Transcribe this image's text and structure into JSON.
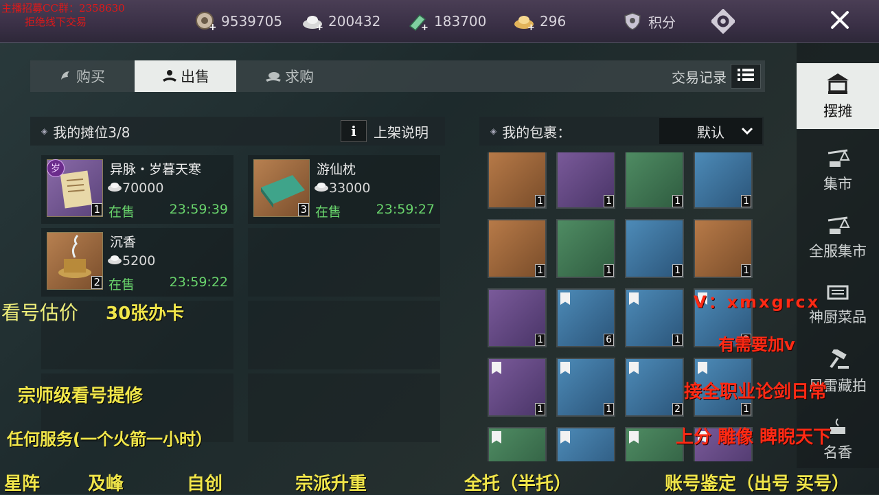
{
  "stream_overlay": {
    "top_left": [
      "主播招募CC群：2358630",
      "拒绝线下交易"
    ],
    "left_lines": [
      "看号估价",
      "30张办卡",
      "宗师级看号提修",
      "任何服务(一个火箭一小时）"
    ],
    "right_lines": [
      "V：xmxgrcx",
      "有需要加v",
      "接全职业论剑日常",
      "上分 雕像 睥睨天下"
    ],
    "bottom_line": [
      "星阵",
      "及峰",
      "自创",
      "宗派升重",
      "全托（半托）",
      "账号鉴定（出号 买号）"
    ]
  },
  "currencies": [
    {
      "icon": "coin-add-icon",
      "value": "9539705"
    },
    {
      "icon": "silver-ingot-icon",
      "value": "200432"
    },
    {
      "icon": "jade-add-icon",
      "value": "183700"
    },
    {
      "icon": "gold-ingot-icon",
      "value": "296"
    }
  ],
  "points_label": "积分",
  "tabs": [
    {
      "label": "购买",
      "icon": "buy-icon"
    },
    {
      "label": "出售",
      "icon": "sell-icon"
    },
    {
      "label": "求购",
      "icon": "request-icon"
    }
  ],
  "trade_record_label": "交易记录",
  "stall": {
    "title": "我的摊位3/8",
    "info_label": "i",
    "guide_label": "上架说明",
    "items": [
      {
        "name": "异脉・岁暮天寒",
        "price": "70000",
        "status": "在售",
        "timer": "23:59:39",
        "qty": "1",
        "badge": "岁"
      },
      {
        "name": "游仙枕",
        "price": "33000",
        "status": "在售",
        "timer": "23:59:27",
        "qty": "3"
      },
      {
        "name": "沉香",
        "price": "5200",
        "status": "在售",
        "timer": "23:59:22",
        "qty": "2"
      }
    ]
  },
  "bag": {
    "title": "我的包裹：",
    "sort_value": "默认",
    "cells": [
      {
        "q": "1",
        "color": "orange",
        "tag": false
      },
      {
        "q": "1",
        "color": "purple",
        "tag": false
      },
      {
        "q": "1",
        "color": "green",
        "tag": false
      },
      {
        "q": "1",
        "color": "blue",
        "tag": false
      },
      {
        "q": "1",
        "color": "orange",
        "tag": false
      },
      {
        "q": "1",
        "color": "green",
        "tag": false
      },
      {
        "q": "1",
        "color": "blue",
        "tag": false
      },
      {
        "q": "1",
        "color": "orange",
        "tag": false
      },
      {
        "q": "1",
        "color": "purple",
        "tag": false
      },
      {
        "q": "6",
        "color": "blue",
        "tag": true
      },
      {
        "q": "1",
        "color": "blue",
        "tag": true
      },
      {
        "q": "2",
        "color": "blue",
        "tag": true
      },
      {
        "q": "1",
        "color": "purple",
        "tag": true
      },
      {
        "q": "1",
        "color": "blue",
        "tag": true
      },
      {
        "q": "2",
        "color": "blue",
        "tag": true
      },
      {
        "q": "1",
        "color": "blue",
        "tag": true
      },
      {
        "q": "",
        "color": "green",
        "tag": true
      },
      {
        "q": "",
        "color": "blue",
        "tag": true
      },
      {
        "q": "",
        "color": "green",
        "tag": true
      },
      {
        "q": "",
        "color": "purple",
        "tag": true
      }
    ]
  },
  "nav": [
    {
      "label": "摆摊",
      "icon": "stall-icon"
    },
    {
      "label": "集市",
      "icon": "scale-icon"
    },
    {
      "label": "全服集市",
      "icon": "scale-icon"
    },
    {
      "label": "神厨菜品",
      "icon": "kitchen-icon"
    },
    {
      "label": "风雷藏拍",
      "icon": "gavel-icon"
    },
    {
      "label": "名香",
      "icon": "incense-icon"
    }
  ]
}
